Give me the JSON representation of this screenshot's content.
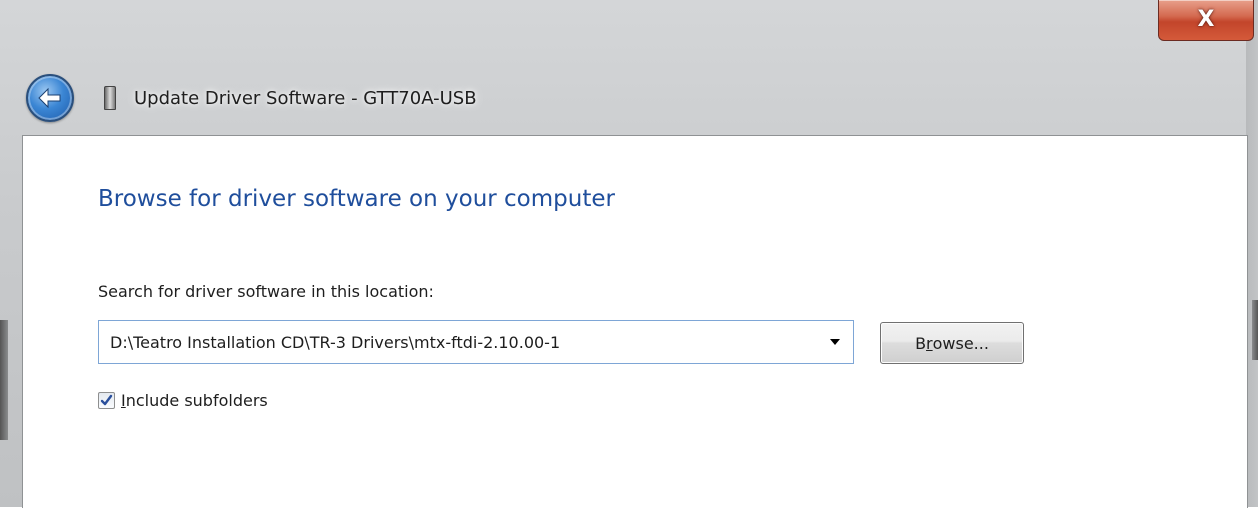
{
  "window": {
    "title": "Update Driver Software - GTT70A-USB",
    "close_glyph": "X",
    "back_icon": "back-arrow-icon",
    "device_icon": "usb-device-icon"
  },
  "page": {
    "heading": "Browse for driver software on your computer",
    "location_label": "Search for driver software in this location:",
    "location_value": "D:\\Teatro Installation CD\\TR-3 Drivers\\mtx-ftdi-2.10.00-1",
    "browse_prefix": "B",
    "browse_accel": "r",
    "browse_suffix": "owse...",
    "include_subfolders_accel": "I",
    "include_subfolders_rest": "nclude subfolders",
    "include_subfolders_checked": true
  },
  "colors": {
    "heading": "#1f4e9c",
    "close_button": "#c2452b",
    "back_button": "#3b86d4"
  }
}
